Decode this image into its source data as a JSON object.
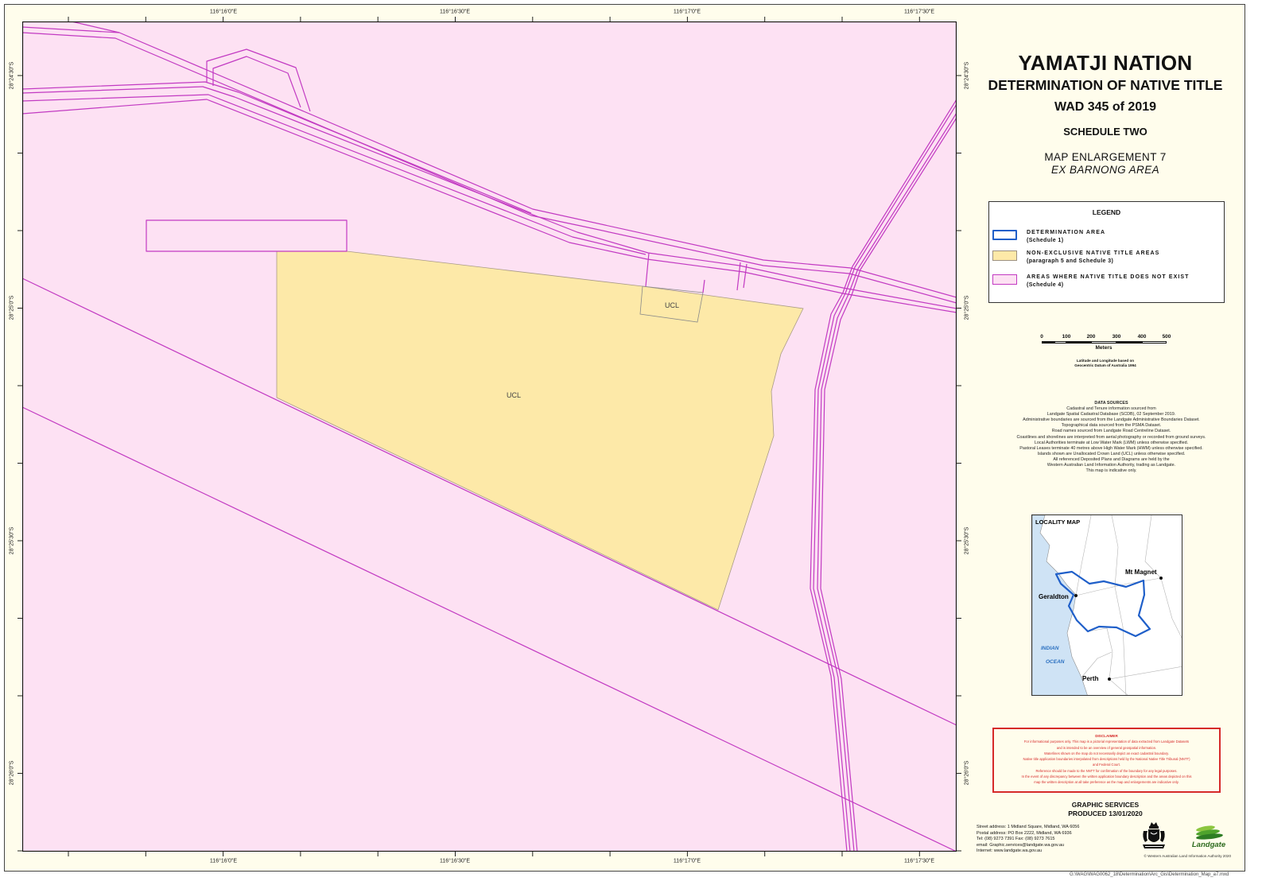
{
  "title": {
    "line1": "YAMATJI NATION",
    "line2": "DETERMINATION OF NATIVE TITLE",
    "line3": "WAD 345 of 2019",
    "schedule": "SCHEDULE TWO",
    "enlargement": "MAP ENLARGEMENT 7",
    "area": "EX BARNONG AREA"
  },
  "coords": {
    "lon": [
      "116°16'0\"E",
      "116°16'30\"E",
      "116°17'0\"E",
      "116°17'30\"E"
    ],
    "lat": [
      "28°24'30\"S",
      "28°25'0\"S",
      "28°25'30\"S",
      "28°26'0\"S"
    ]
  },
  "map_labels": [
    "UCL",
    "UCL"
  ],
  "legend": {
    "title": "LEGEND",
    "items": [
      {
        "label": "DETERMINATION AREA",
        "sub": "(Schedule 1)"
      },
      {
        "label": "NON-EXCLUSIVE NATIVE TITLE AREAS",
        "sub": "(paragraph 5 and Schedule 3)"
      },
      {
        "label": "AREAS WHERE NATIVE TITLE DOES NOT EXIST",
        "sub": "(Schedule 4)"
      }
    ]
  },
  "scale": {
    "ticks": [
      "0",
      "100",
      "200",
      "300",
      "400",
      "500"
    ],
    "unit": "Meters"
  },
  "datum": [
    "Latitude and Longitude based on",
    "Geocentric Datum of Australia 1994"
  ],
  "data_sources": {
    "heading": "DATA SOURCES",
    "lines": [
      "Cadastral and Tenure information sourced from",
      "Landgate Spatial Cadastral Database (SCDB), 02 September 2019.",
      "Administrative boundaries are sourced from the Landgate Administrative Boundaries Dataset.",
      "Topographical data sourced from the PSMA Dataset.",
      "Road names sourced from Landgate Road Centreline Dataset.",
      "Coastlines and shorelines are interpreted from aerial photography or recorded from ground surveys.",
      "Local Authorities terminate at Low Water Mark (LWM) unless otherwise specified.",
      "Pastoral Leases terminate 40 metres above High Water Mark (HWM) unless otherwise specified.",
      "Islands shown are Unallocated Crown Land (UCL) unless otherwise specified.",
      "All referenced Deposited Plans and Diagrams are held by the",
      "Western Australian Land Information Authority, trading as Landgate.",
      "This map is indicative only."
    ]
  },
  "locality": {
    "title": "LOCALITY MAP",
    "places": [
      "Mt Magnet",
      "Geraldton",
      "Perth"
    ],
    "ocean": [
      "INDIAN",
      "OCEAN"
    ]
  },
  "disclaimer": {
    "heading": "DISCLAIMER",
    "lines": [
      "For informational purposes only. This map is a pictorial representation of data extracted from Landgate Datasets",
      "and is intended to be an overview of general geospatial information.",
      "Waterlines shown on the map do not necessarily depict an exact cadastral boundary.",
      "Native title application boundaries interpolated from descriptions held by the National Native Title Tribunal (NNTT)",
      "and Federal Court.",
      "Reference should be made to the NNTT for confirmation of the boundary for any legal purposes.",
      "In the event of any discrepancy between the written application boundary description and the areas depicted on this",
      "map the written description at all take preference as the map and enlargements are indicative only."
    ]
  },
  "credits": {
    "dept": "GRAPHIC SERVICES",
    "produced": "PRODUCED 13/01/2020",
    "address": [
      "Street address: 1 Midland Square, Midland, WA 6056",
      "Postal address: PO Box 2222, Midland, WA 6936",
      "Tel: (08) 9273 7391   Fax: (08) 9273 7615",
      "email: Graphic.services@landgate.wa.gov.au",
      "Internet: www.landgate.wa.gov.au"
    ],
    "logo_text": "Landgate",
    "copyright": "© Western Australian Land Information Authority 2020",
    "path": "G:\\WAG\\WAG0062_18\\Determination\\Arc_Gis\\Determination_Map_a7.mxd"
  },
  "colors": {
    "non_exclusive_fill": "#fde9a8",
    "no_native_title_fill": "#fde1f3",
    "boundary_line": "#c23ac2",
    "determination_outline": "#1f5fc9",
    "disclaimer": "#d62a2a",
    "ocean": "#cfe3f5"
  }
}
